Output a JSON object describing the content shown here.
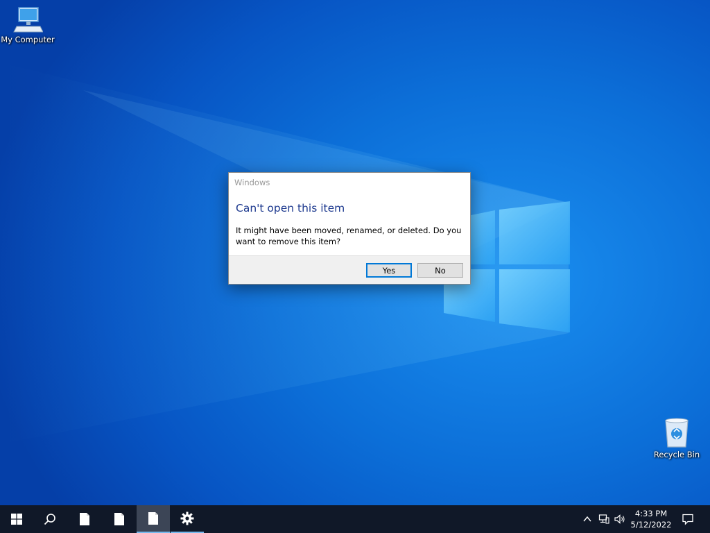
{
  "desktop": {
    "icons": [
      {
        "label": "My Computer",
        "icon": "computer-icon"
      },
      {
        "label": "Recycle Bin",
        "icon": "recycle-bin-icon"
      }
    ]
  },
  "dialog": {
    "window_title": "Windows",
    "heading": "Can't open this item",
    "message": "It might have been moved, renamed, or deleted. Do you want to remove this item?",
    "buttons": {
      "yes": "Yes",
      "no": "No"
    },
    "default_button": "yes"
  },
  "taskbar": {
    "items": [
      {
        "icon": "start-windows-icon",
        "state": "normal"
      },
      {
        "icon": "search-icon",
        "state": "normal"
      },
      {
        "icon": "document-icon",
        "state": "normal"
      },
      {
        "icon": "document-icon",
        "state": "normal"
      },
      {
        "icon": "document-icon",
        "state": "active"
      },
      {
        "icon": "gear-icon",
        "state": "running"
      }
    ],
    "tray": {
      "icons": [
        "chevron-up-icon",
        "network-icon",
        "speaker-icon",
        "notification-icon"
      ],
      "time": "4:33 PM",
      "date": "5/12/2022"
    }
  },
  "colors": {
    "wallpaper_blue": "#0c6fd8",
    "dialog_heading": "#1e3a8f",
    "taskbar": "#101828",
    "accent": "#0078d7"
  }
}
